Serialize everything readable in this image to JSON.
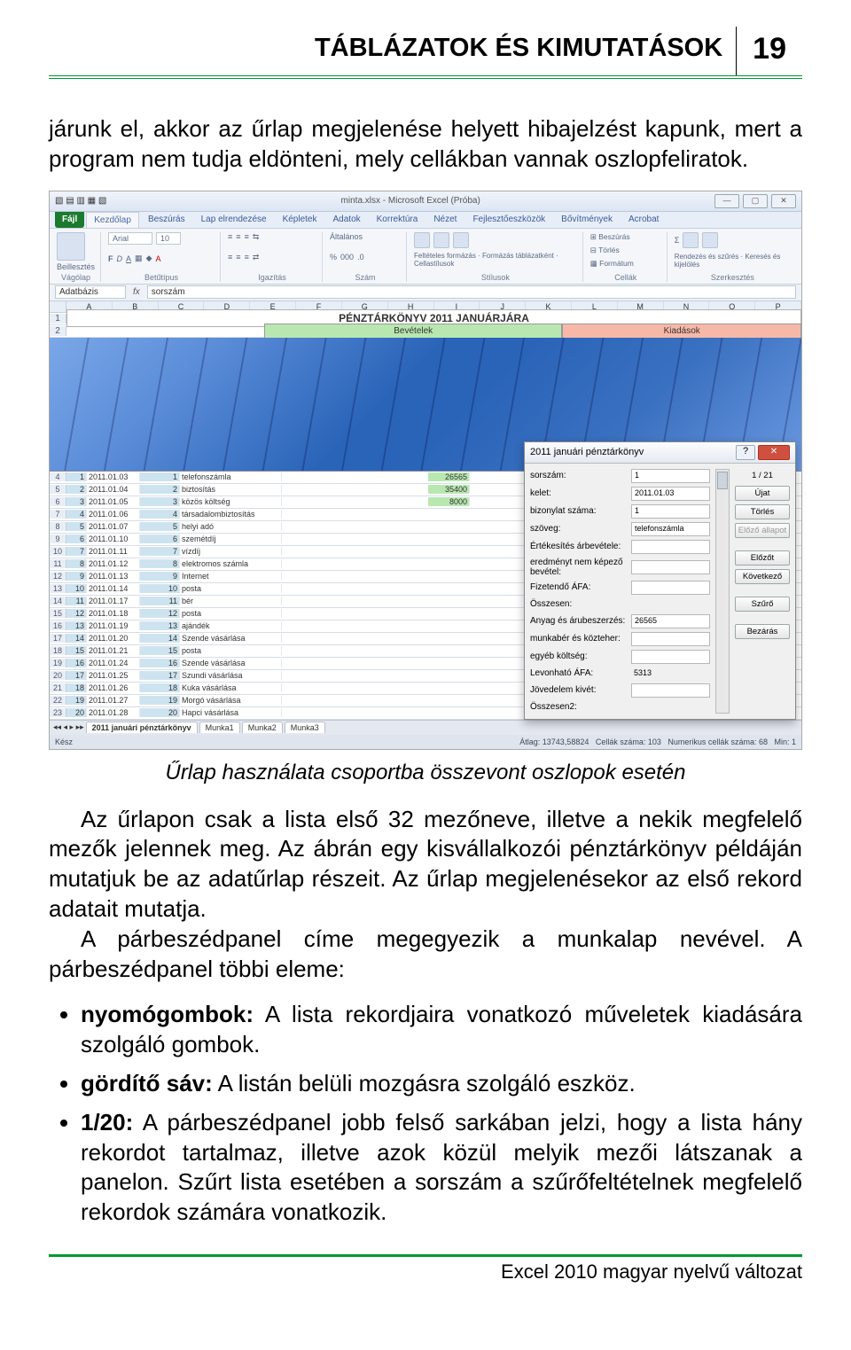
{
  "header": {
    "title": "TÁBLÁZATOK ÉS KIMUTATÁSOK",
    "page": "19"
  },
  "intro": "járunk el, akkor az űrlap megjelenése helyett hibajelzést kapunk, mert a program nem tudja eldönteni, mely cellákban vannak oszlopfeliratok.",
  "app": {
    "title": "minta.xlsx - Microsoft Excel (Próba)",
    "tabs": {
      "file": "Fájl",
      "list": [
        "Kezdőlap",
        "Beszúrás",
        "Lap elrendezése",
        "Képletek",
        "Adatok",
        "Korrektúra",
        "Nézet",
        "Fejlesztőeszközök",
        "Bővítmények",
        "Acrobat"
      ],
      "active": "Kezdőlap"
    },
    "groups": {
      "clipboard": "Vágólap",
      "paste": "Beillesztés",
      "font": "Betűtípus",
      "fontname": "Arial",
      "fontsize": "10",
      "align": "Igazítás",
      "wrap": "Általános",
      "number": "Szám",
      "styles": "Stílusok",
      "cond": "Feltételes formázás",
      "fmt_tbl": "Formázás táblázatként",
      "cellstyle": "Cellastílusok",
      "cells": "Cellák",
      "insert": "Beszúrás",
      "delete": "Törlés",
      "format": "Formátum",
      "editing": "Szerkesztés",
      "sort": "Rendezés és szűrés",
      "find": "Keresés és kijelölés"
    },
    "namebox": "Adatbázis",
    "formula": "sorszám",
    "cols": [
      "A",
      "B",
      "C",
      "D",
      "E",
      "F",
      "G",
      "H",
      "I",
      "J",
      "K",
      "L",
      "M",
      "N",
      "O",
      "P"
    ],
    "sheet_title": "PÉNZTÁRKÖNYV 2011 JANUÁRJÁRA",
    "bands": {
      "bev": "Bevételek",
      "kia": "Kiadások"
    },
    "rows": [
      {
        "n": "4",
        "a": "1",
        "b": "2011.01.03",
        "c": "1",
        "d": "telefonszámla",
        "i": "26565"
      },
      {
        "n": "5",
        "a": "2",
        "b": "2011.01.04",
        "c": "2",
        "d": "biztosítás",
        "i": "35400"
      },
      {
        "n": "6",
        "a": "3",
        "b": "2011.01.05",
        "c": "3",
        "d": "közös költség",
        "i": "8000"
      },
      {
        "n": "7",
        "a": "4",
        "b": "2011.01.06",
        "c": "4",
        "d": "társadalombiztosítás",
        "i": ""
      },
      {
        "n": "8",
        "a": "5",
        "b": "2011.01.07",
        "c": "5",
        "d": "helyi adó",
        "i": ""
      },
      {
        "n": "9",
        "a": "6",
        "b": "2011.01.10",
        "c": "6",
        "d": "szemétdíj",
        "i": ""
      },
      {
        "n": "10",
        "a": "7",
        "b": "2011.01.11",
        "c": "7",
        "d": "vízdíj",
        "i": ""
      },
      {
        "n": "11",
        "a": "8",
        "b": "2011.01.12",
        "c": "8",
        "d": "elektromos számla",
        "i": ""
      },
      {
        "n": "12",
        "a": "9",
        "b": "2011.01.13",
        "c": "9",
        "d": "Internet",
        "i": ""
      },
      {
        "n": "13",
        "a": "10",
        "b": "2011.01.14",
        "c": "10",
        "d": "posta",
        "i": ""
      },
      {
        "n": "14",
        "a": "11",
        "b": "2011.01.17",
        "c": "11",
        "d": "bér",
        "i": ""
      },
      {
        "n": "15",
        "a": "12",
        "b": "2011.01.18",
        "c": "12",
        "d": "posta",
        "i": ""
      },
      {
        "n": "16",
        "a": "13",
        "b": "2011.01.19",
        "c": "13",
        "d": "ajándék",
        "i": ""
      },
      {
        "n": "17",
        "a": "14",
        "b": "2011.01.20",
        "c": "14",
        "d": "Szende vásárlása",
        "i": ""
      },
      {
        "n": "18",
        "a": "15",
        "b": "2011.01.21",
        "c": "15",
        "d": "posta",
        "i": ""
      },
      {
        "n": "19",
        "a": "16",
        "b": "2011.01.24",
        "c": "16",
        "d": "Szende vásárlása",
        "i": ""
      },
      {
        "n": "20",
        "a": "17",
        "b": "2011.01.25",
        "c": "17",
        "d": "Szundi vásárlása",
        "i": ""
      },
      {
        "n": "21",
        "a": "18",
        "b": "2011.01.26",
        "c": "18",
        "d": "Kuka vásárlása",
        "i": ""
      },
      {
        "n": "22",
        "a": "19",
        "b": "2011.01.27",
        "c": "19",
        "d": "Morgó vásárlása",
        "i": ""
      },
      {
        "n": "23",
        "a": "20",
        "b": "2011.01.28",
        "c": "20",
        "d": "Hapci vásárlása",
        "i": ""
      }
    ],
    "sheets": {
      "active": "2011 januári pénztárkönyv",
      "others": [
        "Munka1",
        "Munka2",
        "Munka3"
      ]
    },
    "status": {
      "ready": "Kész",
      "avg": "Átlag: 13743,58824",
      "count": "Cellák száma: 103",
      "numcount": "Numerikus cellák száma: 68",
      "min": "Min: 1"
    }
  },
  "dialog": {
    "title": "2011 januári pénztárkönyv",
    "counter": "1 / 21",
    "fields": [
      {
        "label": "sorszám:",
        "value": "1",
        "editable": true
      },
      {
        "label": "kelet:",
        "value": "2011.01.03",
        "editable": true
      },
      {
        "label": "bizonylat száma:",
        "value": "1",
        "editable": true
      },
      {
        "label": "szöveg:",
        "value": "telefonszámla",
        "editable": true
      },
      {
        "label": "Értékesítés árbevétele:",
        "value": "",
        "editable": true
      },
      {
        "label": "eredményt nem képező bevétel:",
        "value": "",
        "editable": true
      },
      {
        "label": "Fizetendő ÁFA:",
        "value": "",
        "editable": true
      },
      {
        "label": "Összesen:",
        "value": "",
        "editable": false
      },
      {
        "label": "Anyag és árubeszerzés:",
        "value": "26565",
        "editable": true
      },
      {
        "label": "munkabér és közteher:",
        "value": "",
        "editable": true
      },
      {
        "label": "egyéb költség:",
        "value": "",
        "editable": true
      },
      {
        "label": "Levonható ÁFA:",
        "value": "5313",
        "editable": false
      },
      {
        "label": "Jövedelem kivét:",
        "value": "",
        "editable": true
      },
      {
        "label": "Összesen2:",
        "value": "",
        "editable": false
      }
    ],
    "buttons": {
      "new": "Újat",
      "delete": "Törlés",
      "restore": "Előző állapot",
      "prev": "Előzőt",
      "next": "Következő",
      "filter": "Szűrő",
      "close": "Bezárás"
    }
  },
  "caption": "Űrlap használata csoportba összevont oszlopok esetén",
  "body": {
    "p1a": "Az űrlapon csak a lista első 32 mezőneve, illetve a nekik megfelelő mezők jelennek meg. Az ábrán egy kisvállalkozói pénztárkönyv példáján mutatjuk be az adatűrlap részeit. Az űrlap megjelenésekor az első rekord adatait mutatja.",
    "p1b": "A párbeszédpanel címe megegyezik a munkalap nevével. A párbeszédpanel többi eleme:",
    "b1_label": "nyomógombok:",
    "b1_text": " A lista rekordjaira vonatkozó műveletek kiadására szolgáló gombok.",
    "b2_label": "gördítő sáv:",
    "b2_text": " A listán belüli mozgásra szolgáló eszköz.",
    "b3_label": "1/20:",
    "b3_text": " A párbeszédpanel jobb felső sarkában jelzi, hogy a lista hány rekordot tartalmaz, illetve azok közül melyik mezői látszanak a panelon. Szűrt lista esetében a sorszám a szűrőfeltételnek megfelelő rekordok számára vonatkozik."
  },
  "footer": "Excel 2010 magyar nyelvű változat"
}
